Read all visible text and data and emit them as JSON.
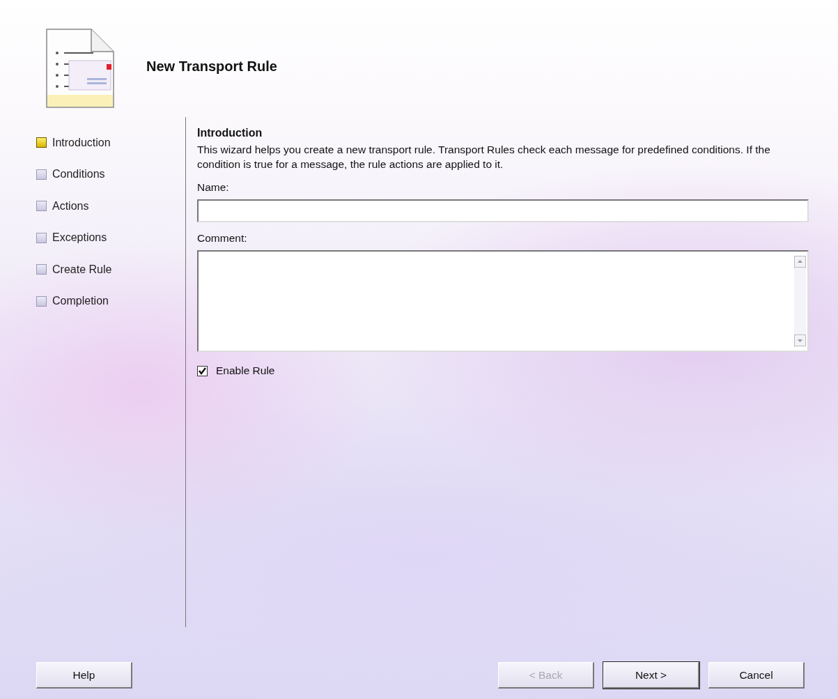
{
  "wizard": {
    "title": "New Transport Rule"
  },
  "steps": [
    {
      "label": "Introduction",
      "selected": true
    },
    {
      "label": "Conditions",
      "selected": false
    },
    {
      "label": "Actions",
      "selected": false
    },
    {
      "label": "Exceptions",
      "selected": false
    },
    {
      "label": "Create Rule",
      "selected": false
    },
    {
      "label": "Completion",
      "selected": false
    }
  ],
  "page": {
    "heading": "Introduction",
    "description": "This wizard helps you create a new transport rule. Transport Rules check each message for predefined conditions. If the condition is true for a message, the rule actions are applied to it.",
    "name_label": "Name:",
    "comment_label": "Comment:",
    "enable_rule": {
      "label": "Enable Rule",
      "checked": true
    }
  },
  "buttons_left": [
    {
      "label": "Help",
      "disabled": false,
      "default": false
    }
  ],
  "buttons_right": [
    {
      "label": "< Back",
      "disabled": true,
      "default": false
    },
    {
      "label": "Next >",
      "disabled": false,
      "default": true
    },
    {
      "label": "Cancel",
      "disabled": false,
      "default": false
    }
  ]
}
